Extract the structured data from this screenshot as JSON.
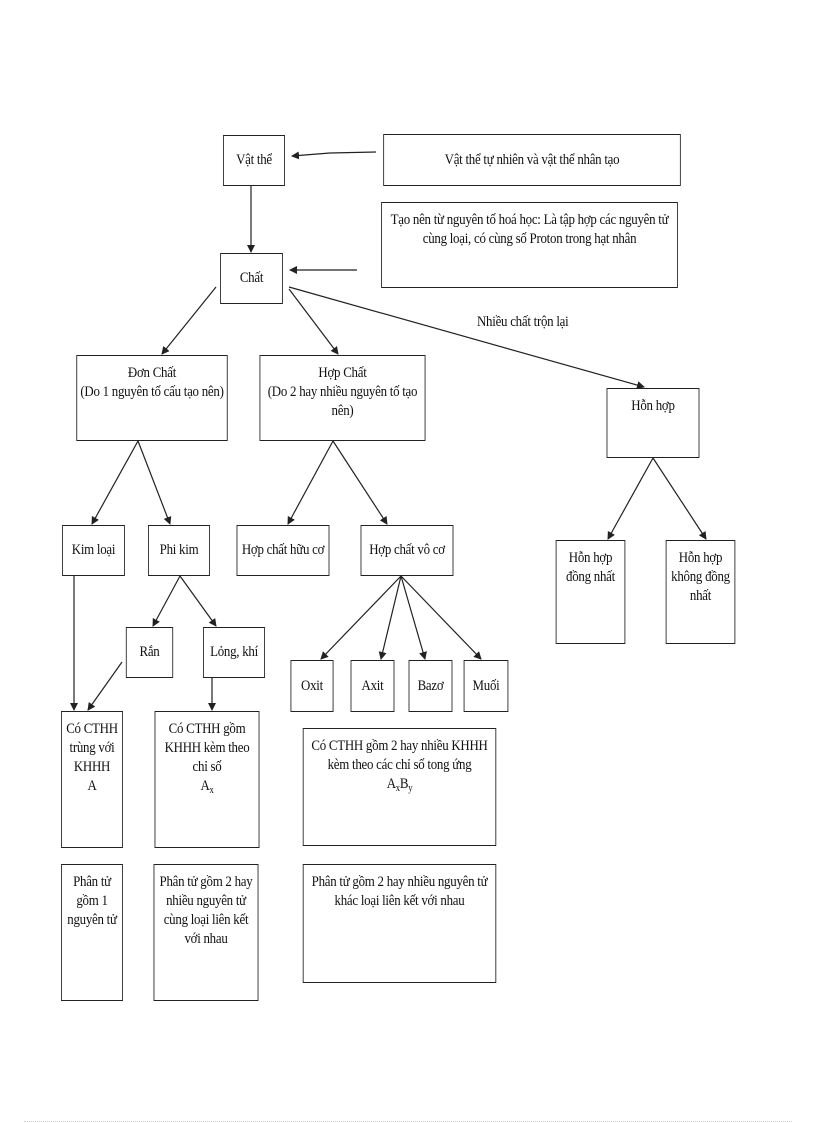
{
  "diagram": {
    "nodes": {
      "vat_the": "Vật thể",
      "vat_the_desc": "Vật thể tự nhiên và vật thể nhân tạo",
      "chat_desc": [
        "Tạo nên từ nguyên tố hoá học: Là tập hợp các nguyên tử",
        "cùng loại, có cùng số Proton trong hạt nhân"
      ],
      "chat": "Chất",
      "don_chat": [
        "Đơn Chất",
        "(Do 1 nguyên tố cấu tạo nên)"
      ],
      "hop_chat": [
        "Hợp Chất",
        "(Do 2 hay nhiều nguyên tố tạo nên)"
      ],
      "hon_hop": "Hỗn hợp",
      "kim_loai": "Kim loại",
      "phi_kim": "Phi kim",
      "hop_chat_huu_co": "Hợp chất hữu cơ",
      "hop_chat_vo_co": "Hợp chất vô cơ",
      "hon_hop_dong_nhat": [
        "Hỗn hợp",
        "đồng nhất"
      ],
      "hon_hop_khong_dong_nhat": [
        "Hỗn hợp",
        "không đồng",
        "nhất"
      ],
      "ran": "Rắn",
      "long_khi": "Lỏng, khí",
      "oxit": "Oxit",
      "axit": "Axit",
      "bazo": "Bazơ",
      "muoi": "Muối",
      "cthh_kim_loai": [
        "Có CTHH",
        "trùng với",
        "KHHH",
        "A"
      ],
      "cthh_phi_kim": [
        "Có CTHH gồm",
        "KHHH kèm theo",
        "chỉ số"
      ],
      "cthh_phi_kim_formula": {
        "base": "A",
        "sub": "x"
      },
      "cthh_hop_chat": [
        "Có CTHH gồm 2 hay nhiều KHHH",
        "kèm theo các chỉ số tong   ứng"
      ],
      "cthh_hop_chat_formula": {
        "a": "A",
        "a_sub": "x",
        "b": "B",
        "b_sub": "y"
      },
      "phan_tu_kim_loai": [
        "Phân tử",
        "gồm 1",
        "nguyên tử"
      ],
      "phan_tu_phi_kim": [
        "Phân tử gồm 2 hay",
        "nhiều nguyên tử",
        "cùng loại liên kết",
        "với nhau"
      ],
      "phan_tu_hop_chat": [
        "Phân tử gồm 2 hay nhiều nguyên tử",
        "khác loại liên kết với nhau"
      ]
    },
    "edge_labels": {
      "chat_to_hon_hop": "Nhiều chất trộn lại"
    },
    "colors": {
      "stroke": "#222222",
      "background": "#ffffff"
    }
  }
}
